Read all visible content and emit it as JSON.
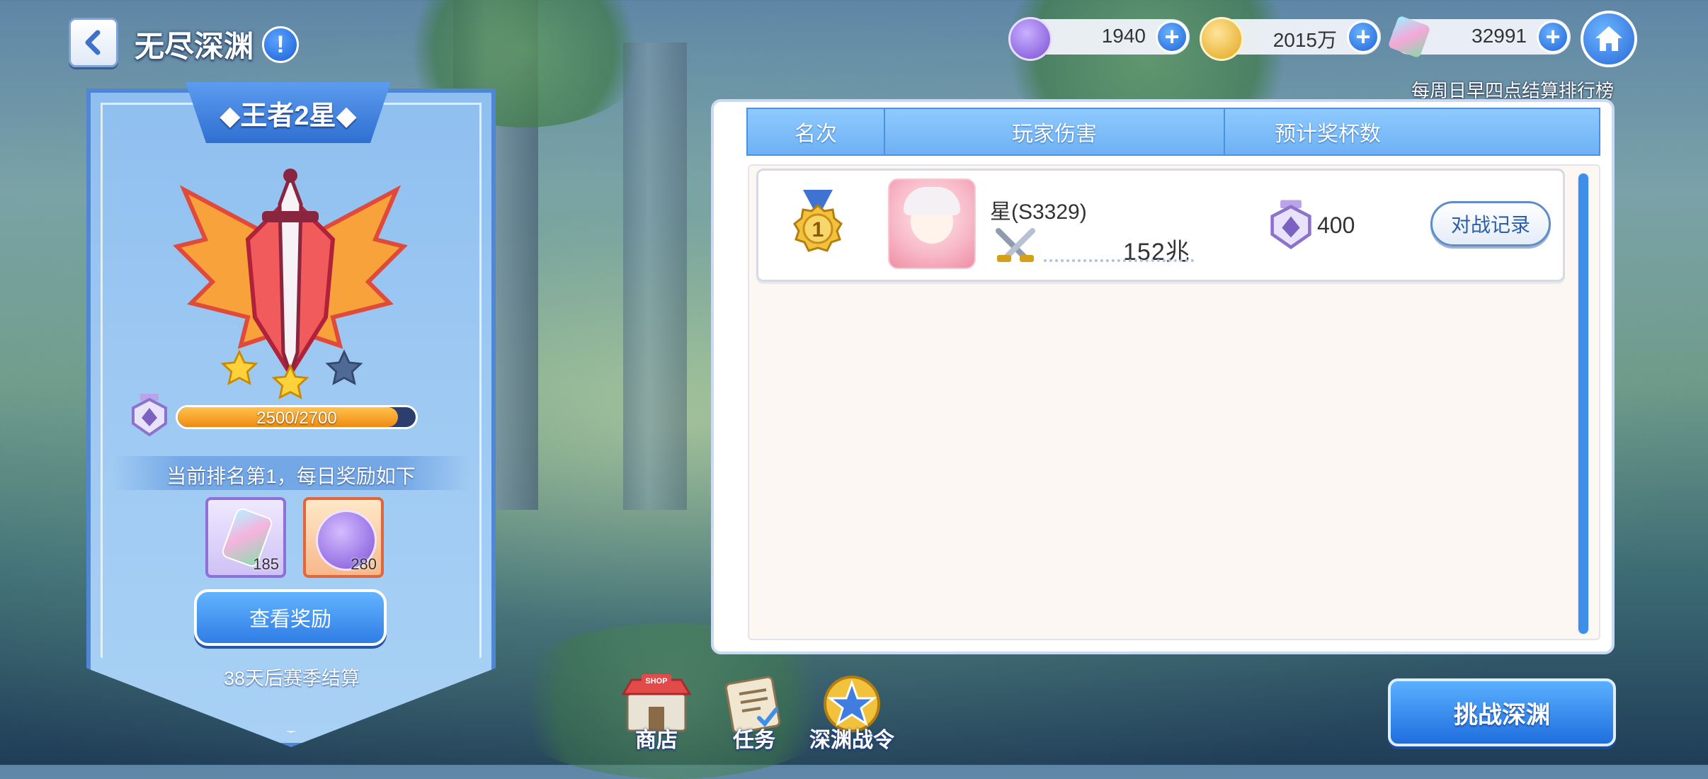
{
  "header": {
    "title": "无尽深渊",
    "info_icon": "!"
  },
  "currencies": [
    {
      "name": "purple-coin",
      "value": "1940",
      "color": "#9a72e6"
    },
    {
      "name": "gold-coin",
      "value": "2015万",
      "color": "#f5c542"
    },
    {
      "name": "crystal",
      "value": "32991",
      "color": "#7fd1e6"
    }
  ],
  "settle_note": "每周日早四点结算排行榜",
  "rank_panel": {
    "rank_title": "◆王者2星◆",
    "stars_filled": 2,
    "stars_total": 3,
    "progress_text": "2500/2700",
    "progress_value": 2500,
    "progress_max": 2700,
    "reward_text": "当前排名第1，每日奖励如下",
    "rewards": [
      {
        "icon": "crystal-icon",
        "count": "185"
      },
      {
        "icon": "purple-coin-icon",
        "count": "280"
      }
    ],
    "view_reward_label": "查看奖励",
    "season_text": "38天后赛季结算"
  },
  "leaderboard": {
    "columns": [
      "名次",
      "玩家伤害",
      "预计奖杯数"
    ],
    "rows": [
      {
        "rank": "1",
        "name": "星(S3329)",
        "damage": "152兆",
        "cups": "400",
        "record_label": "对战记录"
      }
    ]
  },
  "bottom_nav": [
    {
      "label": "商店",
      "icon": "shop-icon",
      "badge": "SHOP"
    },
    {
      "label": "任务",
      "icon": "task-scroll-icon"
    },
    {
      "label": "深渊战令",
      "icon": "star-medal-icon"
    }
  ],
  "challenge_label": "挑战深渊"
}
